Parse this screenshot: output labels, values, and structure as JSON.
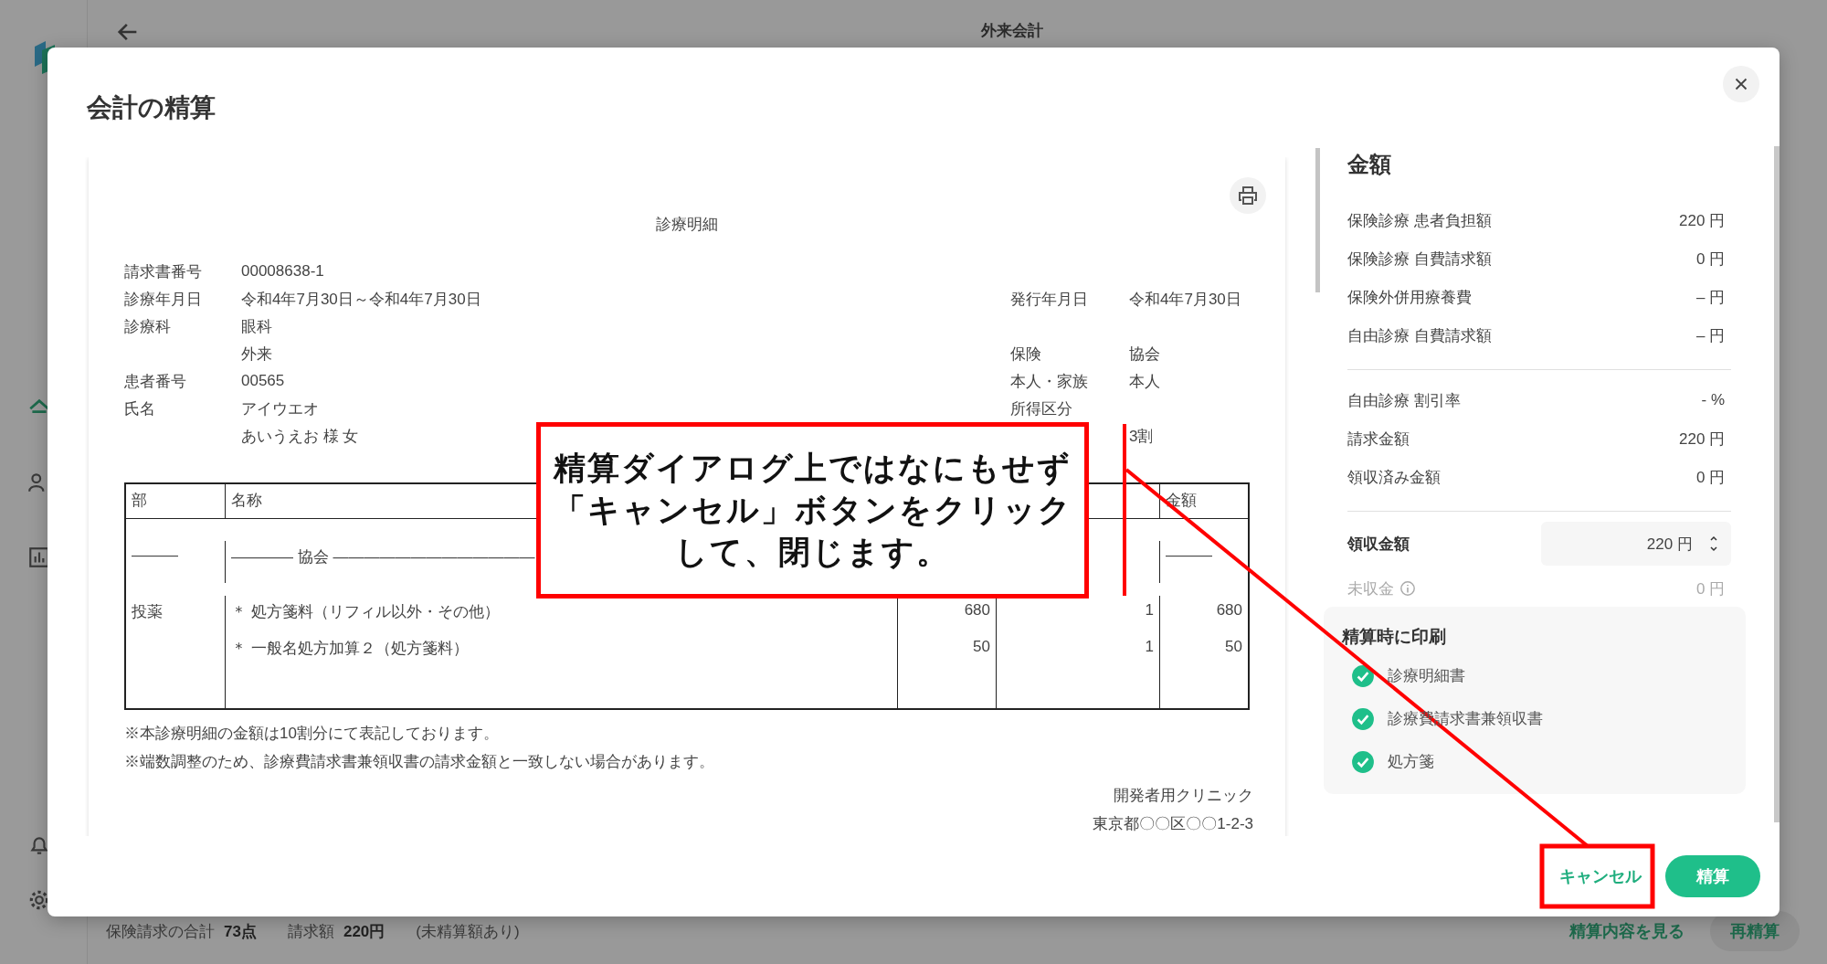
{
  "background": {
    "header": {
      "title": "外来会計"
    },
    "summary": [
      {
        "kind": "label",
        "text": "保険請求の合計"
      },
      {
        "kind": "strong",
        "text": "73点"
      },
      {
        "kind": "label",
        "text": "請求額"
      },
      {
        "kind": "strong",
        "text": "220円"
      },
      {
        "kind": "label",
        "text": "(未精算額あり)"
      }
    ],
    "actions": [
      {
        "kind": "link",
        "label": "精算内容を見る"
      },
      {
        "kind": "button",
        "label": "再精算"
      }
    ]
  },
  "dialog": {
    "title": "会計の精算",
    "statement": {
      "title": "診療明細",
      "info_rows": [
        {
          "left_label": "請求書番号",
          "left_value": "00008638-1"
        },
        {
          "left_label": "診療年月日",
          "left_value": "令和4年7月30日～令和4年7月30日",
          "right_label": "発行年月日",
          "right_value": "令和4年7月30日"
        },
        {
          "left_label": "診療科",
          "left_value": "眼科"
        },
        {
          "left_value": "外来",
          "right_label": "保険",
          "right_value": "協会"
        },
        {
          "left_label": "患者番号",
          "left_value": "00565",
          "right_label": "本人・家族",
          "right_value": "本人"
        },
        {
          "left_label": "氏名",
          "left_value": "アイウエオ",
          "right_label": "所得区分"
        },
        {
          "left_value": "あいうえお 様 女",
          "right_value": "3割"
        }
      ],
      "table": {
        "header": {
          "col_1": "部",
          "col_2": "名称",
          "col_5": "金額"
        },
        "rows": [
          {
            "col_1": "―――",
            "col_2": "―――― 協会 ―――――――――――――",
            "col_5": "―――"
          },
          {
            "col_1": "投薬",
            "col_2": "＊ 処方箋料（リフィル以外・その他）",
            "col_3": "680",
            "col_4": "1",
            "col_5": "680"
          },
          {
            "col_2": "＊ 一般名処方加算２（処方箋料）",
            "col_3": "50",
            "col_4": "1",
            "col_5": "50"
          }
        ]
      },
      "notes": [
        "※本診療明細の金額は10割分にて表記しております。",
        "※端数調整のため、診療費請求書兼領収書の請求金額と一致しない場合があります。"
      ],
      "clinic": [
        "開発者用クリニック",
        "東京都〇〇区〇〇1-2-3"
      ]
    },
    "amounts": {
      "title": "金額",
      "groups": [
        [
          {
            "label": "保険診療 患者負担額",
            "value": "220 円"
          },
          {
            "label": "保険診療 自費請求額",
            "value": "0 円"
          },
          {
            "label": "保険外併用療養費",
            "value": "– 円"
          },
          {
            "label": "自由診療 自費請求額",
            "value": "– 円"
          }
        ],
        [
          {
            "label": "自由診療 割引率",
            "value": "- %"
          },
          {
            "label": "請求金額",
            "value": "220 円"
          },
          {
            "label": "領収済み金額",
            "value": "0 円"
          }
        ]
      ],
      "received": {
        "label": "領収金額",
        "value": "220 円"
      },
      "unpaid": {
        "label": "未収金",
        "value": "0 円",
        "disabled": true
      }
    },
    "print": {
      "title": "精算時に印刷",
      "items": [
        {
          "label": "診療明細書",
          "checked": true
        },
        {
          "label": "診療費請求書兼領収書",
          "checked": true
        },
        {
          "label": "処方箋",
          "checked": true
        }
      ]
    },
    "buttons": [
      {
        "kind": "text",
        "label": "キャンセル"
      },
      {
        "kind": "primary",
        "label": "精算"
      }
    ]
  },
  "annotation": {
    "lines": [
      "精算ダイアログ上ではなにもせず",
      "「キャンセル」ボタンをクリック",
      "して、閉じます。"
    ]
  }
}
